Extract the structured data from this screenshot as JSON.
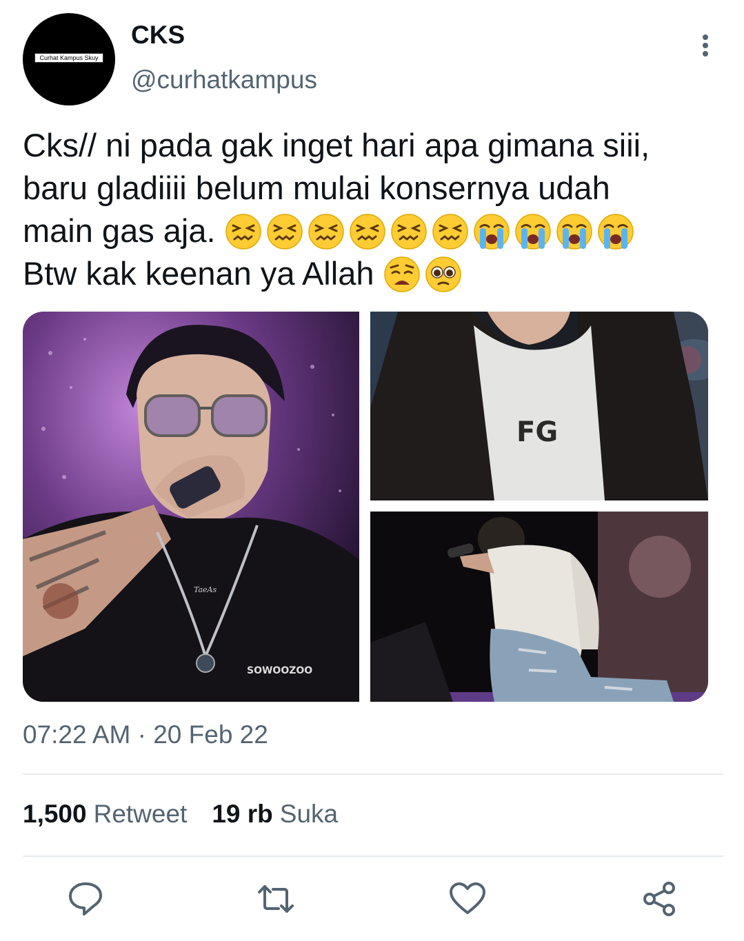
{
  "author": {
    "name": "CKS",
    "handle": "@curhatkampus",
    "avatar_text": "Curhat Kampus Skuy"
  },
  "tweet": {
    "line1": "Cks// ni pada gak inget hari apa gimana siii,",
    "line2": "baru gladiiii belum mulai konsernya udah",
    "line3": "main gas aja.",
    "line4": "Btw kak keenan ya Allah",
    "line3_emojis": [
      "confounded-face-emoji",
      "confounded-face-emoji",
      "confounded-face-emoji",
      "confounded-face-emoji",
      "confounded-face-emoji",
      "confounded-face-emoji",
      "loudly-crying-face-emoji",
      "loudly-crying-face-emoji",
      "loudly-crying-face-emoji",
      "loudly-crying-face-emoji"
    ],
    "line4_emojis": [
      "weary-face-emoji",
      "pleading-face-emoji"
    ],
    "images": [
      {
        "caption_text": "TaeAs",
        "shirt_text": "SOWOOZOO"
      },
      {
        "shirt_text": "FG"
      },
      {}
    ]
  },
  "meta": {
    "timestamp": "07:22 AM · 20 Feb 22"
  },
  "stats": {
    "retweet_count": "1,500",
    "retweet_label": "Retweet",
    "like_count": "19 rb",
    "like_label": "Suka"
  },
  "colors": {
    "text_primary": "#0f1419",
    "text_secondary": "#536471",
    "divider": "#e6ecf0",
    "emoji_yellow": "#ffcc33"
  },
  "actions": [
    "reply-icon",
    "retweet-icon",
    "like-icon",
    "share-icon"
  ]
}
